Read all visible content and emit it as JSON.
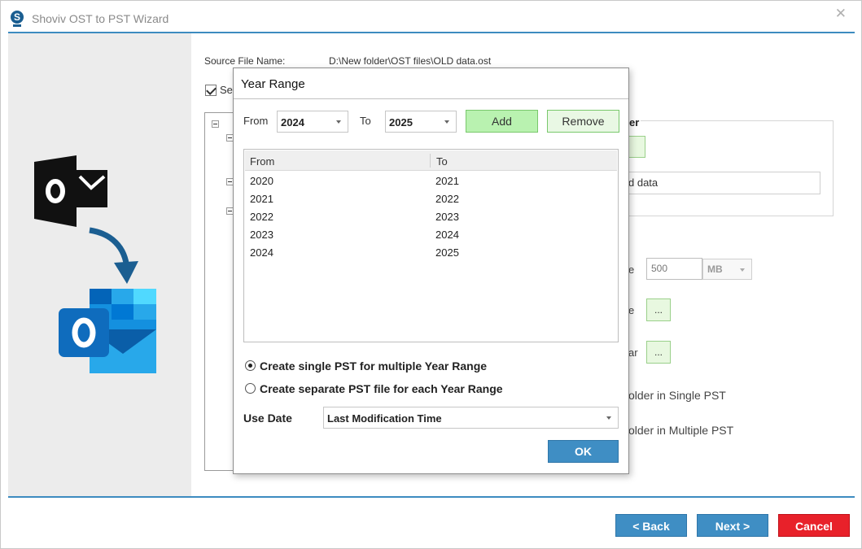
{
  "window": {
    "title": "Shoviv OST to PST Wizard",
    "close_glyph": "✕"
  },
  "background": {
    "source_label": "Source File Name:",
    "source_value": "D:\\New folder\\OST files\\OLD data.ost",
    "select_label": "Se",
    "group_title_fragment": "er",
    "field_fragment": "d data",
    "size_label_fragment": "e",
    "size_value": "500",
    "size_unit": "MB",
    "browse_label_fragment_1": "e",
    "browse_label_fragment_2": "ar",
    "browse_button": "...",
    "option_fragment_single": "older in Single PST",
    "option_fragment_multiple": "older in Multiple PST"
  },
  "navigation": {
    "back": "< Back",
    "next": "Next >",
    "cancel": "Cancel"
  },
  "dialog": {
    "title": "Year Range",
    "from_label": "From",
    "from_value": "2024",
    "to_label": "To",
    "to_value": "2025",
    "add_button": "Add",
    "remove_button": "Remove",
    "columns": [
      "From",
      "To"
    ],
    "rows": [
      {
        "from": "2020",
        "to": "2021"
      },
      {
        "from": "2021",
        "to": "2022"
      },
      {
        "from": "2022",
        "to": "2023"
      },
      {
        "from": "2023",
        "to": "2024"
      },
      {
        "from": "2024",
        "to": "2025"
      }
    ],
    "radio_single": "Create single PST for multiple Year Range",
    "radio_separate": "Create separate PST file for each Year Range",
    "selected_option": "single",
    "use_date_label": "Use Date",
    "use_date_value": "Last Modification Time",
    "ok_button": "OK"
  },
  "colors": {
    "accent_blue": "#3f8ec4",
    "cancel_red": "#e8212a",
    "add_green": "#b9f2b0",
    "outlook_blue": "#0f6cbd"
  },
  "icons": {
    "app": "shoviv-logo-icon",
    "ost": "ost-file-icon",
    "arrow": "curved-arrow-icon",
    "pst": "outlook-pst-icon"
  }
}
